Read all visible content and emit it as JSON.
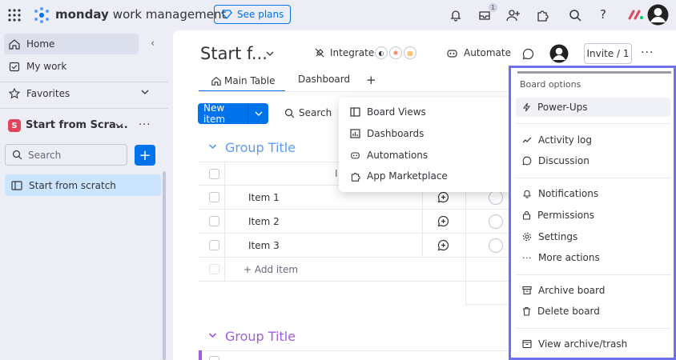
{
  "topbar": {
    "brand_bold": "monday",
    "brand_light": "work management",
    "see_plans": "See plans",
    "inbox_badge": "1"
  },
  "sidebar": {
    "home": "Home",
    "my_work": "My work",
    "favorites": "Favorites",
    "workspace_name": "Start from Scra...",
    "workspace_letter": "S",
    "search_placeholder": "Search",
    "board_item": "Start from scratch"
  },
  "board": {
    "title": "Start f...",
    "integrate": "Integrate",
    "automate": "Automate",
    "invite": "Invite / 1",
    "tabs": [
      "Main Table",
      "Dashboard"
    ],
    "new_item": "New item",
    "search": "Search",
    "groups": [
      {
        "title": "Group Title",
        "items": [
          "Item 1",
          "Item 2",
          "Item 3"
        ],
        "add_item": "+ Add item"
      },
      {
        "title": "Group Title"
      }
    ]
  },
  "views_popup": {
    "items": [
      "Board Views",
      "Dashboards",
      "Automations",
      "App Marketplace"
    ]
  },
  "board_menu": {
    "header": "Board options",
    "items": [
      "Power-Ups",
      "Activity log",
      "Discussion",
      "Notifications",
      "Permissions",
      "Settings",
      "More actions",
      "Archive board",
      "Delete board",
      "View archive/trash"
    ]
  },
  "colors": {
    "primary": "#0073ea",
    "group": "#579bfc",
    "group2": "#a25ddc",
    "highlight": "#6d72ec"
  }
}
